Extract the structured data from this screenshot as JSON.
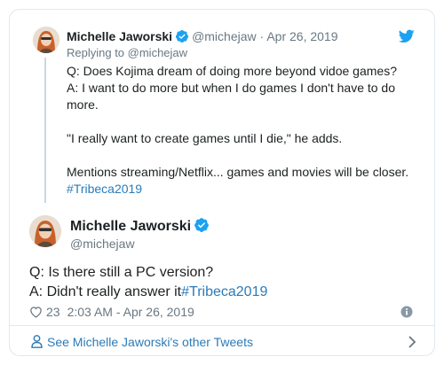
{
  "parent_tweet": {
    "author_name": "Michelle Jaworski",
    "handle": "@michejaw",
    "separator": "·",
    "date": "Apr 26, 2019",
    "replying_to": "Replying to @michejaw",
    "lines": [
      "Q: Does Kojima dream of doing more beyond vidoe games?",
      "A: I want to do more but when I do games I don't have to do",
      "more.",
      "",
      "\"I really want to create games until I die,\" he adds.",
      "",
      "Mentions streaming/Netflix... games and movies will be closer."
    ],
    "hashtag": "#Tribeca2019"
  },
  "main_tweet": {
    "author_name": "Michelle Jaworski",
    "handle": "@michejaw",
    "line1": "Q: Is there still a PC version?",
    "line2_text": "A: Didn't really answer it",
    "line2_hashtag": "#Tribeca2019",
    "like_count": "23",
    "timestamp": "2:03 AM - Apr 26, 2019"
  },
  "footer": {
    "label": "See Michelle Jaworski's other Tweets"
  },
  "colors": {
    "link": "#2b7bb9",
    "muted": "#697882",
    "verified": "#1da1f2",
    "border": "#e1e8ed"
  },
  "icons": [
    "twitter-bird-icon",
    "verified-badge-icon",
    "heart-icon",
    "info-icon",
    "person-icon",
    "chevron-right-icon"
  ]
}
